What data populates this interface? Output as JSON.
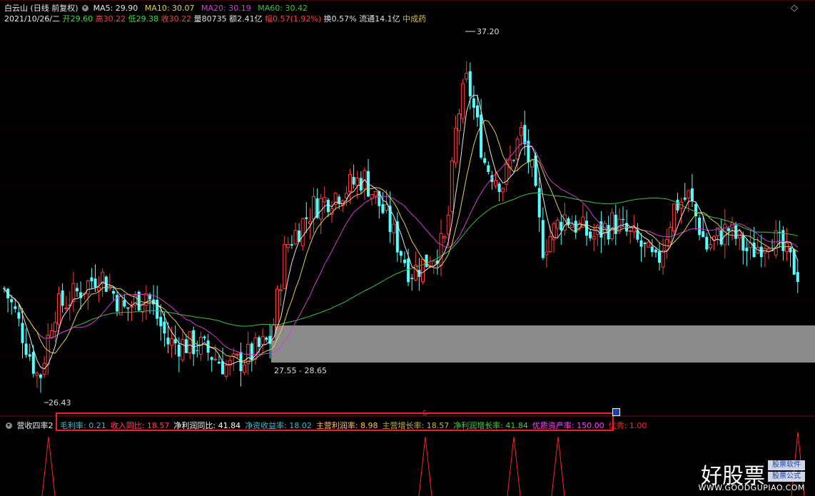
{
  "header": {
    "stock_name": "白云山",
    "adjust_mode": "(日线 前复权)",
    "ma5_label": "MA5: 29.90",
    "ma10_label": "MA10: 30.07",
    "ma20_label": "MA20: 30.19",
    "ma60_label": "MA60: 30.42",
    "date": "2021/10/26/二",
    "open": "开29.60",
    "high": "高30.22",
    "low": "低29.38",
    "close": "收30.22",
    "volume": "量80735",
    "amount": "额2.41亿",
    "change": "幅0.57(1.92%)",
    "turnover": "换0.57%",
    "float_cap": "流通14.1亿",
    "sector": "中成药"
  },
  "chart": {
    "max_label": "37.20",
    "min_label": "26.43",
    "zone_label": "27.55 - 28.65",
    "price_range": [
      25.8,
      38.0
    ],
    "ma_colors": {
      "ma5": "#e6e6e6",
      "ma10": "#e0d050",
      "ma20": "#d040d0",
      "ma60": "#40c040"
    },
    "candle_colors": {
      "up": "#ff3c3c",
      "down": "#54ffff"
    },
    "zone_color": "#8a8a8a"
  },
  "indicator": {
    "name": "营收四率2",
    "items": [
      {
        "label": "毛利率: 0.21",
        "color": "#40b8c8"
      },
      {
        "label": "收入同比: 18.57",
        "color": "#ff4060"
      },
      {
        "label": "净利润同比: 41.84",
        "color": "#ffffff"
      },
      {
        "label": "净资收益率: 18.02",
        "color": "#40b8c8"
      },
      {
        "label": "主营利润率: 8.98",
        "color": "#ffc060"
      },
      {
        "label": "主营增长率: 18.57",
        "color": "#c0b040"
      },
      {
        "label": "净利润增长率: 41.84",
        "color": "#40d040"
      },
      {
        "label": "优质资产率: 150.00",
        "color": "#ff40ff"
      },
      {
        "label": "优秀: 1.00",
        "color": "#ff2020"
      }
    ],
    "marker_label": "S"
  },
  "watermark": {
    "brand": "好股票",
    "tag1": "股票软件",
    "tag2": "股票公式",
    "url": "WWW.GOODGUPIAO.COM"
  }
}
